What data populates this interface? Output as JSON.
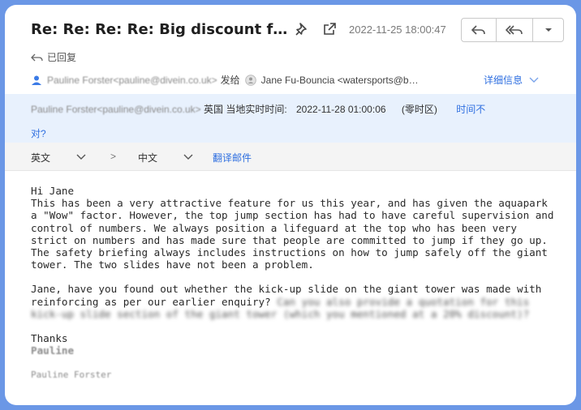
{
  "email": {
    "subject": "Re: Re: Re: Re: Big discount f…",
    "date": "2022-11-25 18:00:47",
    "replied_status": "已回复",
    "sender": "Pauline Forster<pauline@divein.co.uk>",
    "sent_to_label": "发给",
    "recipient": "Jane Fu-Bouncia <watersports@b…",
    "details_link": "详细信息"
  },
  "notice": {
    "sender": "Pauline Forster<pauline@divein.co.uk>",
    "local_time_label": "英国 当地实时时间:",
    "local_time": "2022-11-28 01:00:06",
    "timezone": "(零时区)",
    "wrong_time_link_part1": "时间不",
    "wrong_time_link_part2": "对?"
  },
  "translate": {
    "source_lang": "英文",
    "arrow": ">",
    "target_lang": "中文",
    "translate_button": "翻译邮件"
  },
  "body": {
    "greeting": "Hi Jane",
    "paragraph1": "This has been a very attractive feature for us this year, and has given the aquapark a \"Wow\" factor. However, the top jump section has had to have careful supervision and control of numbers. We always position a lifeguard at the top who has been very strict on numbers and has made sure that people are committed to jump if they go up. The safety briefing always includes instructions on how to jump safely off the giant tower. The two slides have not been a problem.",
    "paragraph2_clear": "Jane, have you found out whether the kick-up slide on the giant tower was made with reinforcing as per our earlier enquiry?",
    "paragraph2_blurred": "Can you also provide a quotation for this kick-up slide section of the giant tower (which you mentioned at a 20% discount)?",
    "closing": "Thanks",
    "signoff_name": "Pauline",
    "signature": "Pauline Forster"
  },
  "icons": [
    "pin-icon",
    "popout-icon",
    "reply-icon",
    "reply-all-icon",
    "more-dropdown-icon",
    "person-icon",
    "contact-icon",
    "chevron-down-icon"
  ]
}
